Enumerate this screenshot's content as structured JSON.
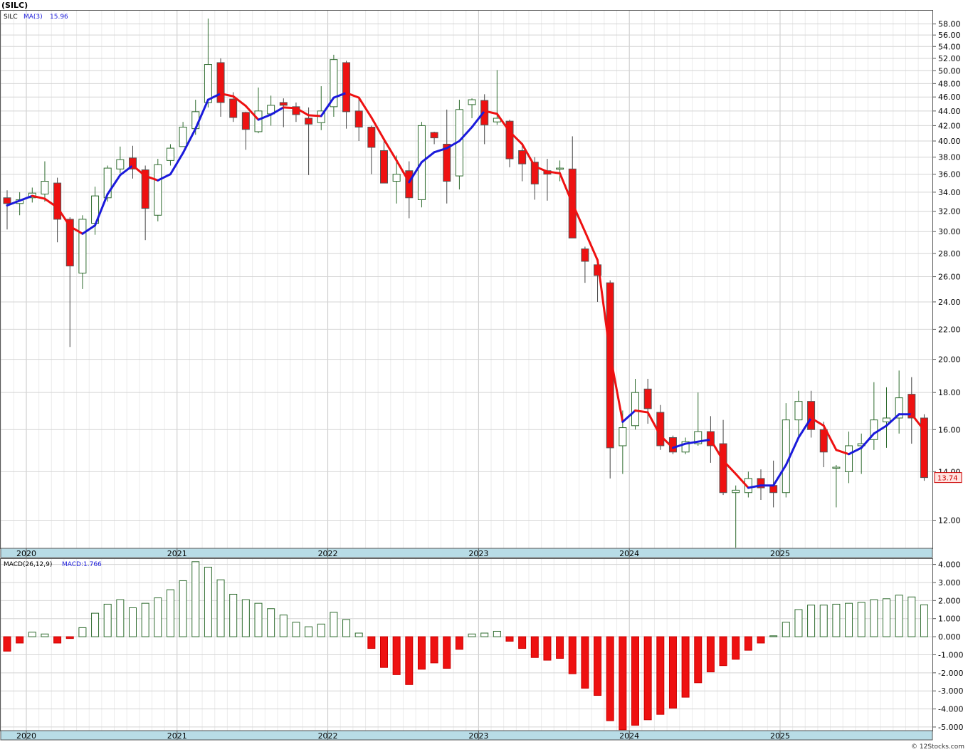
{
  "chart_data": [
    {
      "type": "candlestick",
      "title": "(SILC)",
      "symbol": "SILC",
      "ma_label": "MA(3)",
      "ma_value": "15.96",
      "last_price": "13.74",
      "y_scale": "log",
      "ylim": [
        11.0,
        60.5
      ],
      "yticks": [
        "12.00",
        "14.00",
        "16.00",
        "18.00",
        "20.00",
        "22.00",
        "24.00",
        "26.00",
        "28.00",
        "30.00",
        "32.00",
        "34.00",
        "36.00",
        "38.00",
        "40.00",
        "42.00",
        "44.00",
        "46.00",
        "48.00",
        "50.00",
        "52.00",
        "54.00",
        "56.00",
        "58.00"
      ],
      "x_years": [
        "2020",
        "2021",
        "2022",
        "2023",
        "2024",
        "2025"
      ],
      "grid": true,
      "candles": [
        {
          "o": 33.4,
          "h": 34.2,
          "l": 30.2,
          "c": 32.8
        },
        {
          "o": 32.8,
          "h": 34.0,
          "l": 31.6,
          "c": 33.2
        },
        {
          "o": 33.4,
          "h": 34.5,
          "l": 32.9,
          "c": 33.9
        },
        {
          "o": 33.8,
          "h": 37.5,
          "l": 33.0,
          "c": 35.2
        },
        {
          "o": 35.0,
          "h": 35.6,
          "l": 29.0,
          "c": 31.2
        },
        {
          "o": 31.2,
          "h": 31.4,
          "l": 20.8,
          "c": 26.9
        },
        {
          "o": 26.3,
          "h": 31.6,
          "l": 25.0,
          "c": 31.2
        },
        {
          "o": 30.8,
          "h": 34.6,
          "l": 29.7,
          "c": 33.6
        },
        {
          "o": 33.4,
          "h": 37.0,
          "l": 33.0,
          "c": 36.7
        },
        {
          "o": 36.6,
          "h": 39.3,
          "l": 36.1,
          "c": 37.7
        },
        {
          "o": 37.9,
          "h": 39.4,
          "l": 35.5,
          "c": 36.6
        },
        {
          "o": 36.5,
          "h": 37.0,
          "l": 29.2,
          "c": 32.3
        },
        {
          "o": 31.6,
          "h": 37.8,
          "l": 31.0,
          "c": 37.1
        },
        {
          "o": 37.6,
          "h": 39.6,
          "l": 37.0,
          "c": 39.1
        },
        {
          "o": 39.3,
          "h": 42.5,
          "l": 39.3,
          "c": 41.8
        },
        {
          "o": 41.6,
          "h": 45.6,
          "l": 40.8,
          "c": 43.9
        },
        {
          "o": 45.2,
          "h": 59.0,
          "l": 44.5,
          "c": 51.0
        },
        {
          "o": 51.3,
          "h": 52.0,
          "l": 43.2,
          "c": 45.2
        },
        {
          "o": 45.7,
          "h": 46.7,
          "l": 42.5,
          "c": 43.1
        },
        {
          "o": 43.8,
          "h": 43.9,
          "l": 38.9,
          "c": 41.5
        },
        {
          "o": 41.2,
          "h": 47.4,
          "l": 41.0,
          "c": 44.0
        },
        {
          "o": 43.6,
          "h": 46.2,
          "l": 42.0,
          "c": 44.8
        },
        {
          "o": 45.2,
          "h": 45.8,
          "l": 41.8,
          "c": 44.8
        },
        {
          "o": 44.6,
          "h": 45.2,
          "l": 42.5,
          "c": 43.5
        },
        {
          "o": 43.0,
          "h": 44.5,
          "l": 35.9,
          "c": 42.2
        },
        {
          "o": 42.4,
          "h": 47.6,
          "l": 41.4,
          "c": 44.0
        },
        {
          "o": 44.6,
          "h": 52.6,
          "l": 43.2,
          "c": 51.8
        },
        {
          "o": 51.3,
          "h": 51.6,
          "l": 41.6,
          "c": 43.9
        },
        {
          "o": 44.0,
          "h": 46.0,
          "l": 40.0,
          "c": 41.8
        },
        {
          "o": 41.8,
          "h": 42.0,
          "l": 36.0,
          "c": 39.2
        },
        {
          "o": 38.8,
          "h": 40.0,
          "l": 35.0,
          "c": 35.0
        },
        {
          "o": 35.2,
          "h": 38.2,
          "l": 32.8,
          "c": 36.0
        },
        {
          "o": 36.4,
          "h": 37.5,
          "l": 31.3,
          "c": 33.4
        },
        {
          "o": 33.2,
          "h": 42.5,
          "l": 32.4,
          "c": 42.0
        },
        {
          "o": 41.1,
          "h": 41.2,
          "l": 39.6,
          "c": 40.4
        },
        {
          "o": 39.6,
          "h": 44.2,
          "l": 32.8,
          "c": 35.2
        },
        {
          "o": 35.8,
          "h": 45.6,
          "l": 34.3,
          "c": 44.2
        },
        {
          "o": 44.9,
          "h": 45.8,
          "l": 43.0,
          "c": 45.6
        },
        {
          "o": 45.5,
          "h": 46.4,
          "l": 39.6,
          "c": 42.1
        },
        {
          "o": 42.5,
          "h": 50.1,
          "l": 42.1,
          "c": 43.0
        },
        {
          "o": 42.6,
          "h": 42.8,
          "l": 36.8,
          "c": 37.8
        },
        {
          "o": 38.8,
          "h": 39.4,
          "l": 35.2,
          "c": 37.2
        },
        {
          "o": 37.4,
          "h": 38.0,
          "l": 33.2,
          "c": 34.9
        },
        {
          "o": 36.4,
          "h": 37.8,
          "l": 33.1,
          "c": 36.0
        },
        {
          "o": 36.7,
          "h": 37.6,
          "l": 35.2,
          "c": 36.7
        },
        {
          "o": 36.6,
          "h": 40.6,
          "l": 32.3,
          "c": 29.4
        },
        {
          "o": 28.4,
          "h": 28.6,
          "l": 25.5,
          "c": 27.3
        },
        {
          "o": 27.0,
          "h": 27.2,
          "l": 24.0,
          "c": 26.1
        },
        {
          "o": 25.5,
          "h": 25.7,
          "l": 13.7,
          "c": 15.1
        },
        {
          "o": 15.2,
          "h": 17.0,
          "l": 13.9,
          "c": 16.1
        },
        {
          "o": 16.2,
          "h": 18.8,
          "l": 16.0,
          "c": 18.0
        },
        {
          "o": 18.2,
          "h": 18.8,
          "l": 16.3,
          "c": 17.1
        },
        {
          "o": 16.9,
          "h": 17.3,
          "l": 15.0,
          "c": 15.2
        },
        {
          "o": 15.6,
          "h": 15.7,
          "l": 14.8,
          "c": 14.9
        },
        {
          "o": 14.9,
          "h": 15.6,
          "l": 14.8,
          "c": 15.4
        },
        {
          "o": 15.3,
          "h": 18.0,
          "l": 15.2,
          "c": 15.9
        },
        {
          "o": 15.9,
          "h": 16.7,
          "l": 14.4,
          "c": 15.2
        },
        {
          "o": 15.3,
          "h": 16.5,
          "l": 13.0,
          "c": 13.1
        },
        {
          "o": 13.1,
          "h": 13.4,
          "l": 11.0,
          "c": 13.2
        },
        {
          "o": 13.1,
          "h": 14.0,
          "l": 12.9,
          "c": 13.7
        },
        {
          "o": 13.7,
          "h": 14.1,
          "l": 12.8,
          "c": 13.3
        },
        {
          "o": 13.4,
          "h": 14.5,
          "l": 12.5,
          "c": 13.1
        },
        {
          "o": 13.1,
          "h": 17.4,
          "l": 12.9,
          "c": 16.5
        },
        {
          "o": 16.5,
          "h": 18.1,
          "l": 15.6,
          "c": 17.5
        },
        {
          "o": 17.5,
          "h": 18.1,
          "l": 15.6,
          "c": 16.0
        },
        {
          "o": 16.0,
          "h": 16.4,
          "l": 14.2,
          "c": 14.9
        },
        {
          "o": 14.2,
          "h": 14.3,
          "l": 12.5,
          "c": 14.2
        },
        {
          "o": 14.0,
          "h": 15.9,
          "l": 13.5,
          "c": 15.2
        },
        {
          "o": 15.2,
          "h": 15.8,
          "l": 13.9,
          "c": 15.3
        },
        {
          "o": 15.5,
          "h": 18.6,
          "l": 15.0,
          "c": 16.5
        },
        {
          "o": 16.4,
          "h": 18.3,
          "l": 15.1,
          "c": 16.6
        },
        {
          "o": 16.6,
          "h": 19.3,
          "l": 15.8,
          "c": 17.7
        },
        {
          "o": 17.9,
          "h": 18.9,
          "l": 15.3,
          "c": 16.6
        },
        {
          "o": 16.6,
          "h": 16.8,
          "l": 13.6,
          "c": 13.74
        }
      ],
      "ma_points": [
        32.6,
        33.1,
        33.6,
        33.3,
        32.4,
        30.5,
        29.8,
        30.6,
        33.8,
        35.9,
        37.0,
        35.8,
        35.3,
        36.0,
        38.5,
        41.6,
        45.6,
        46.5,
        46.1,
        44.7,
        42.8,
        43.5,
        44.5,
        44.4,
        43.4,
        43.3,
        45.9,
        46.6,
        45.9,
        43.1,
        40.2,
        37.6,
        35.1,
        37.4,
        38.6,
        39.1,
        40.0,
        41.8,
        44.0,
        43.6,
        41.2,
        39.6,
        36.9,
        36.3,
        36.1,
        32.8,
        30.0,
        27.4,
        20.3,
        16.4,
        17.0,
        16.9,
        15.7,
        15.1,
        15.3,
        15.4,
        15.5,
        14.5,
        13.9,
        13.3,
        13.4,
        13.4,
        14.3,
        15.6,
        16.6,
        16.2,
        15.0,
        14.8,
        15.1,
        15.8,
        16.2,
        16.8,
        16.8,
        15.96
      ]
    },
    {
      "type": "bar",
      "title": "MACD(26,12,9)",
      "macd_label": "MACD:1.766",
      "ylim": [
        -5.2,
        4.3
      ],
      "yticks": [
        "-5.000",
        "-4.000",
        "-3.000",
        "-2.000",
        "-1.000",
        "0.000",
        "1.000",
        "2.000",
        "3.000",
        "4.000"
      ],
      "x_years": [
        "2020",
        "2021",
        "2022",
        "2023",
        "2024",
        "2025"
      ],
      "values": [
        -0.8,
        -0.35,
        0.25,
        0.15,
        -0.35,
        -0.1,
        0.5,
        1.3,
        1.8,
        2.05,
        1.6,
        1.85,
        2.15,
        2.6,
        3.1,
        4.15,
        3.85,
        3.15,
        2.35,
        2.05,
        1.85,
        1.55,
        1.2,
        0.8,
        0.55,
        0.7,
        1.35,
        0.95,
        0.2,
        -0.65,
        -1.7,
        -2.1,
        -2.65,
        -1.8,
        -1.45,
        -1.75,
        -0.7,
        0.15,
        0.2,
        0.3,
        -0.25,
        -0.65,
        -1.15,
        -1.3,
        -1.2,
        -2.05,
        -2.85,
        -3.25,
        -4.65,
        -5.15,
        -4.9,
        -4.6,
        -4.3,
        -3.95,
        -3.35,
        -2.55,
        -1.95,
        -1.6,
        -1.25,
        -0.75,
        -0.35,
        0.05,
        0.8,
        1.5,
        1.75,
        1.75,
        1.8,
        1.85,
        1.9,
        2.05,
        2.1,
        2.3,
        2.2,
        1.766
      ]
    }
  ],
  "watermark": "© 12Stocks.com"
}
